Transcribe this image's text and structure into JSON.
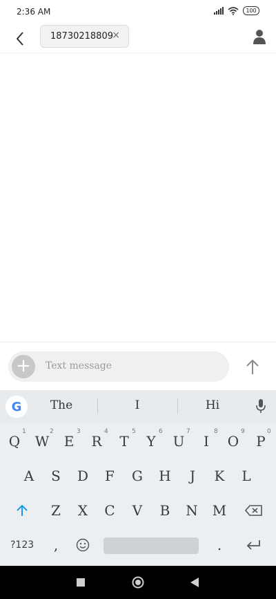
{
  "status_bar": {
    "time": "2:36 AM",
    "battery": "100"
  },
  "header": {
    "recipient": "18730218809",
    "remove_glyph": "×"
  },
  "compose": {
    "placeholder": "Text message",
    "plus_glyph": "+"
  },
  "keyboard": {
    "logo": "G",
    "suggestions": [
      "The",
      "I",
      "Hi"
    ],
    "row1": [
      "Q",
      "W",
      "E",
      "R",
      "T",
      "Y",
      "U",
      "I",
      "O",
      "P"
    ],
    "row1_numbers": [
      "1",
      "2",
      "3",
      "4",
      "5",
      "6",
      "7",
      "8",
      "9",
      "0"
    ],
    "row2": [
      "A",
      "S",
      "D",
      "F",
      "G",
      "H",
      "J",
      "K",
      "L"
    ],
    "row3": [
      "Z",
      "X",
      "C",
      "V",
      "B",
      "N",
      "M"
    ],
    "symbols_label": "?123",
    "comma": ",",
    "period": "."
  },
  "colors": {
    "shift_accent": "#1a9be8",
    "navbar": "#000000"
  },
  "icons": [
    "back-arrow-icon",
    "person-icon",
    "send-arrow-icon",
    "mic-icon",
    "shift-icon",
    "backspace-icon",
    "emoji-icon",
    "enter-icon",
    "nav-square-icon",
    "nav-circle-icon",
    "nav-triangle-icon"
  ]
}
